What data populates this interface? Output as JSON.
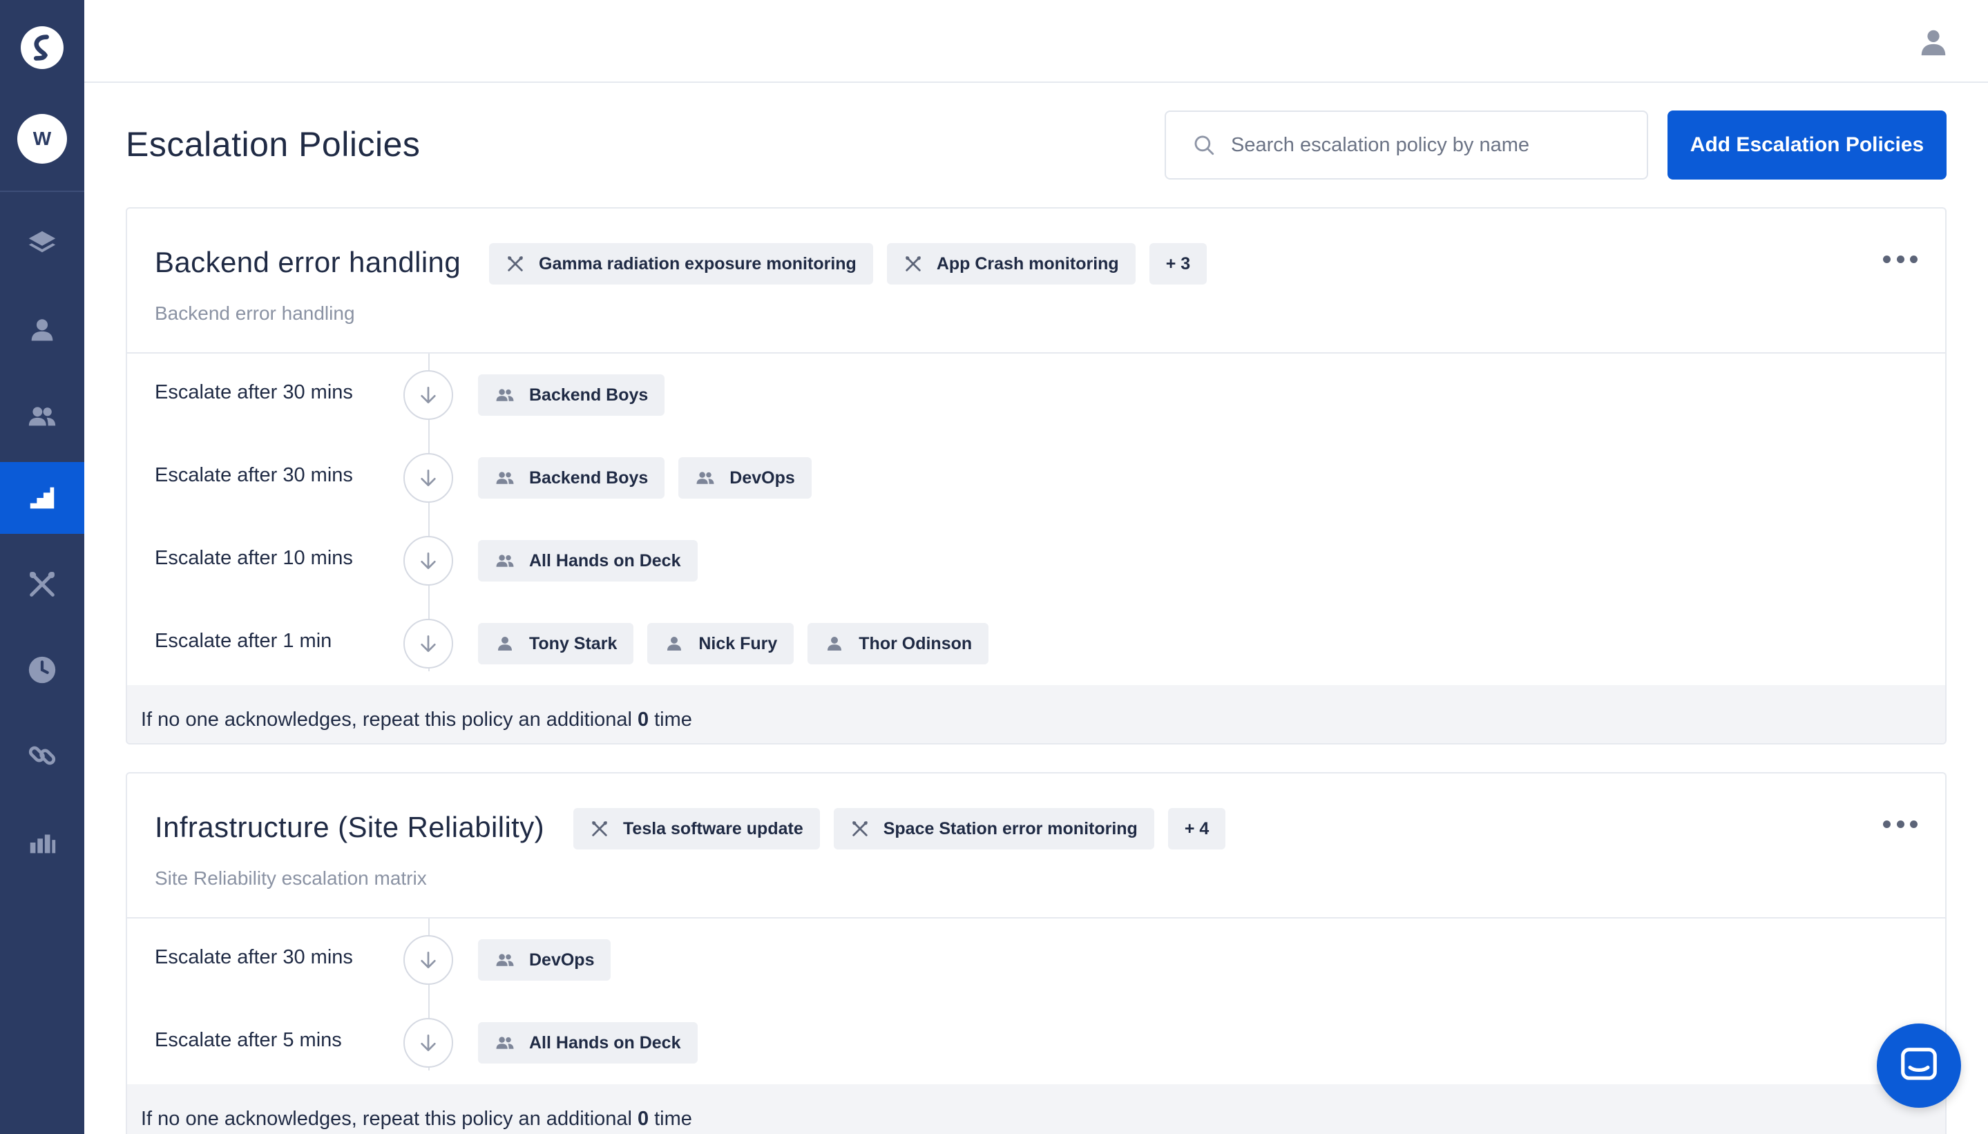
{
  "app": {
    "workspace_initial": "W"
  },
  "colors": {
    "sidebar": "#2b3b63",
    "accent": "#0b5bd7",
    "tag_bg": "#eef0f4"
  },
  "sidebar": {
    "items": [
      {
        "icon": "layers-icon",
        "active": false
      },
      {
        "icon": "user-icon",
        "active": false
      },
      {
        "icon": "users-icon",
        "active": false
      },
      {
        "icon": "escalation-stairs-icon",
        "active": true
      },
      {
        "icon": "tools-icon",
        "active": false
      },
      {
        "icon": "clock-icon",
        "active": false
      },
      {
        "icon": "link-icon",
        "active": false
      },
      {
        "icon": "bar-chart-icon",
        "active": false
      }
    ]
  },
  "header": {
    "title": "Escalation Policies",
    "search_placeholder": "Search escalation policy by name",
    "add_button": "Add Escalation Policies"
  },
  "policies": [
    {
      "name": "Backend error handling",
      "description": "Backend error handling",
      "services": [
        "Gamma radiation exposure monitoring",
        "App Crash monitoring"
      ],
      "more_services": "+ 3",
      "steps": [
        {
          "label": "Escalate after 30 mins",
          "assignees": [
            {
              "type": "team",
              "name": "Backend Boys"
            }
          ]
        },
        {
          "label": "Escalate after 30 mins",
          "assignees": [
            {
              "type": "team",
              "name": "Backend Boys"
            },
            {
              "type": "team",
              "name": "DevOps"
            }
          ]
        },
        {
          "label": "Escalate after 10 mins",
          "assignees": [
            {
              "type": "team",
              "name": "All Hands on Deck"
            }
          ]
        },
        {
          "label": "Escalate after 1 min",
          "assignees": [
            {
              "type": "user",
              "name": "Tony Stark"
            },
            {
              "type": "user",
              "name": "Nick Fury"
            },
            {
              "type": "user",
              "name": "Thor Odinson"
            }
          ]
        }
      ],
      "repeat_prefix": "If no one acknowledges, repeat this policy an additional",
      "repeat_count": "0",
      "repeat_suffix": "time"
    },
    {
      "name": "Infrastructure (Site Reliability)",
      "description": "Site Reliability escalation matrix",
      "services": [
        "Tesla software update",
        "Space Station error monitoring"
      ],
      "more_services": "+ 4",
      "steps": [
        {
          "label": "Escalate after 30 mins",
          "assignees": [
            {
              "type": "team",
              "name": "DevOps"
            }
          ]
        },
        {
          "label": "Escalate after 5 mins",
          "assignees": [
            {
              "type": "team",
              "name": "All Hands on Deck"
            }
          ]
        }
      ],
      "repeat_prefix": "If no one acknowledges, repeat this policy an additional",
      "repeat_count": "0",
      "repeat_suffix": "time"
    }
  ]
}
